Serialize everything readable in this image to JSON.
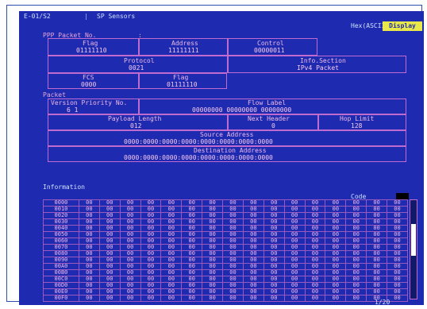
{
  "top_bar": {
    "tab1": "E-01/S2",
    "tab2": "SP Sensors",
    "view_mode": "Hex(ASCII)",
    "badge": "Display"
  },
  "header": {
    "ppp_label": "PPP Packet No.",
    "ppp_value": ":",
    "row1": [
      {
        "label": "Flag",
        "value": "01111110"
      },
      {
        "label": "Address",
        "value": "11111111"
      },
      {
        "label": "Control",
        "value": "00000011"
      }
    ],
    "row2": [
      {
        "label": "Protocol",
        "value": "0021"
      },
      {
        "label": "Info.Section",
        "value": "IPv4 Packet"
      }
    ],
    "row3": [
      {
        "label": "FCS",
        "value": "0000"
      },
      {
        "label": "Flag",
        "value": "01111110"
      }
    ]
  },
  "body": {
    "label": "Packet",
    "row1": [
      {
        "label": "Version Priority No.",
        "value": "6  1"
      },
      {
        "label": "Flow Label",
        "value": "00000000  00000000  00000000"
      }
    ],
    "row2": [
      {
        "label": "Payload Length",
        "value": "012"
      },
      {
        "label": "Next Header",
        "value": "0"
      },
      {
        "label": "Hop Limit",
        "value": "128"
      }
    ],
    "source_label": "Source Address",
    "source_value": "0000:0000:0000:0000:0000:0000:0000:0000",
    "dest_label": "Destination Address",
    "dest_value": "0000:0000:0000:0000:0000:0000:0000:0000"
  },
  "info": {
    "label": "Information",
    "code_label": "Code",
    "rows": [
      [
        "0000",
        "00",
        "00",
        "00",
        "00",
        "00",
        "00",
        "00",
        "00",
        "00",
        "00",
        "00",
        "00",
        "00",
        "00",
        "00",
        "00"
      ],
      [
        "0010",
        "00",
        "00",
        "00",
        "00",
        "00",
        "00",
        "00",
        "00",
        "00",
        "00",
        "00",
        "00",
        "00",
        "00",
        "00",
        "00"
      ],
      [
        "0020",
        "00",
        "00",
        "00",
        "00",
        "00",
        "00",
        "00",
        "00",
        "00",
        "00",
        "00",
        "00",
        "00",
        "00",
        "00",
        "00"
      ],
      [
        "0030",
        "00",
        "00",
        "00",
        "00",
        "00",
        "00",
        "00",
        "00",
        "00",
        "00",
        "00",
        "00",
        "00",
        "00",
        "00",
        "00"
      ],
      [
        "0040",
        "00",
        "00",
        "00",
        "00",
        "00",
        "00",
        "00",
        "00",
        "00",
        "00",
        "00",
        "00",
        "00",
        "00",
        "00",
        "00"
      ],
      [
        "0050",
        "00",
        "00",
        "00",
        "00",
        "00",
        "00",
        "00",
        "00",
        "00",
        "00",
        "00",
        "00",
        "00",
        "00",
        "00",
        "00"
      ],
      [
        "0060",
        "00",
        "00",
        "00",
        "00",
        "00",
        "00",
        "00",
        "00",
        "00",
        "00",
        "00",
        "00",
        "00",
        "00",
        "00",
        "00"
      ],
      [
        "0070",
        "00",
        "00",
        "00",
        "00",
        "00",
        "00",
        "00",
        "00",
        "00",
        "00",
        "00",
        "00",
        "00",
        "00",
        "00",
        "00"
      ],
      [
        "0080",
        "00",
        "00",
        "00",
        "00",
        "00",
        "00",
        "00",
        "00",
        "00",
        "00",
        "00",
        "00",
        "00",
        "00",
        "00",
        "00"
      ],
      [
        "0090",
        "00",
        "00",
        "00",
        "00",
        "00",
        "00",
        "00",
        "00",
        "00",
        "00",
        "00",
        "00",
        "00",
        "00",
        "00",
        "00"
      ],
      [
        "00A0",
        "00",
        "00",
        "00",
        "00",
        "00",
        "00",
        "00",
        "00",
        "00",
        "00",
        "00",
        "00",
        "00",
        "00",
        "00",
        "00"
      ],
      [
        "00B0",
        "00",
        "00",
        "00",
        "00",
        "00",
        "00",
        "00",
        "00",
        "00",
        "00",
        "00",
        "00",
        "00",
        "00",
        "00",
        "00"
      ],
      [
        "00C0",
        "00",
        "00",
        "00",
        "00",
        "00",
        "00",
        "00",
        "00",
        "00",
        "00",
        "00",
        "00",
        "00",
        "00",
        "00",
        "00"
      ],
      [
        "00D0",
        "00",
        "00",
        "00",
        "00",
        "00",
        "00",
        "00",
        "00",
        "00",
        "00",
        "00",
        "00",
        "00",
        "00",
        "00",
        "00"
      ],
      [
        "00E0",
        "00",
        "00",
        "00",
        "00",
        "00",
        "00",
        "00",
        "00",
        "00",
        "00",
        "00",
        "00",
        "00",
        "00",
        "00",
        "00"
      ],
      [
        "00F0",
        "00",
        "00",
        "00",
        "00",
        "00",
        "00",
        "00",
        "00",
        "00",
        "00",
        "00",
        "00",
        "00",
        "00",
        "00",
        "00"
      ]
    ]
  },
  "footer": {
    "page": "1/20"
  }
}
